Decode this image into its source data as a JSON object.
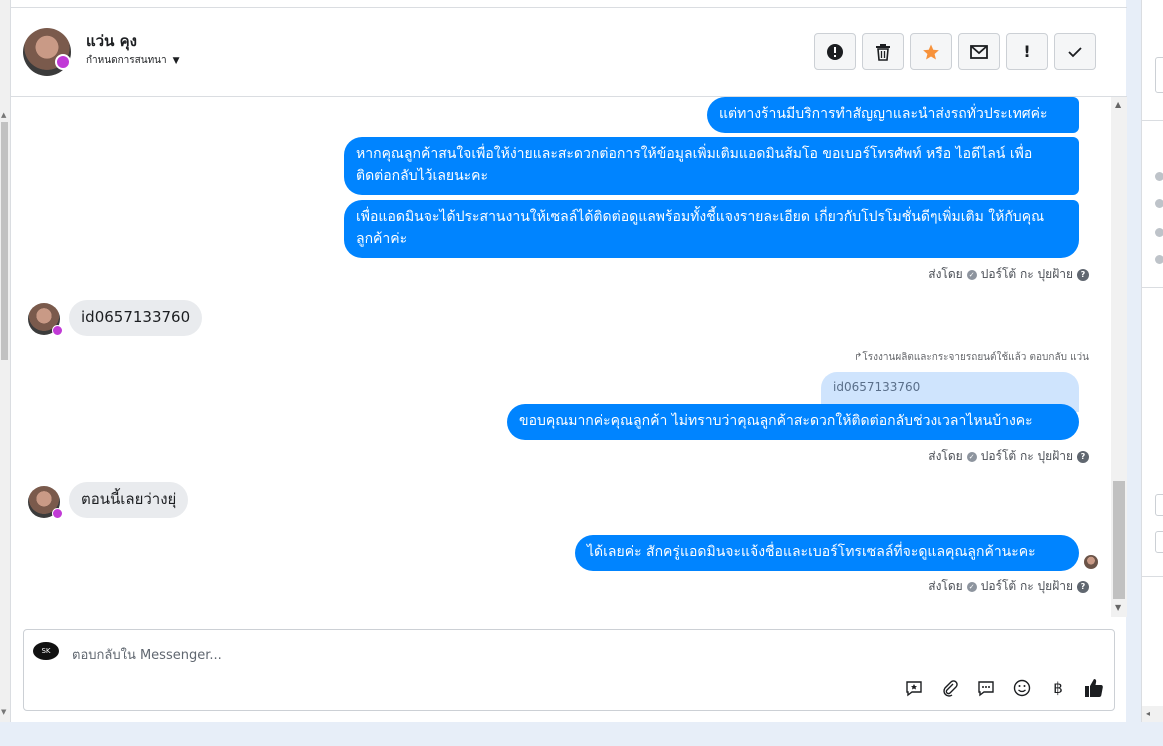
{
  "header": {
    "contact_name": "แว่น คุง",
    "label_dropdown": "กำหนดการสนทนา"
  },
  "toolbar": {
    "buttons": [
      {
        "name": "spam-button",
        "icon": "alert-circle-icon"
      },
      {
        "name": "delete-button",
        "icon": "trash-icon"
      },
      {
        "name": "star-button",
        "icon": "star-icon",
        "color": "#f7923b"
      },
      {
        "name": "mark-unread-button",
        "icon": "envelope-icon"
      },
      {
        "name": "follow-up-button",
        "icon": "exclamation-icon"
      },
      {
        "name": "done-button",
        "icon": "checkmark-icon"
      }
    ]
  },
  "conversation": {
    "out_1": "แต่ทางร้านมีบริการทำสัญญาและนำส่งรถทั่วประเทศค่ะ",
    "out_2": "หากคุณลูกค้าสนใจเพื่อให้ง่ายและสะดวกต่อการให้ข้อมูลเพิ่มเติมแอดมินส้มโอ ขอเบอร์โทรศัพท์ หรือ ไอดีไลน์ เพื่อติดต่อกลับไว้เลยนะคะ",
    "out_3": "เพื่อแอดมินจะได้ประสานงานให้เซลล์ได้ติดต่อดูแลพร้อมทั้งชี้แจงรายละเอียด เกี่ยวกับโปรโมชั่นดีๆเพิ่มเติม ให้กับคุณลูกค้าค่ะ",
    "sent_by_1": "ส่งโดย",
    "sender_1": "ปอร์โต้ กะ ปุยฝ้าย",
    "in_1": "id0657133760",
    "reply_note": "โรงงานผลิตและกระจายรถยนต์ใช้แล้ว ตอบกลับ แว่น",
    "quoted": "id0657133760",
    "out_4": "ขอบคุณมากค่ะคุณลูกค้า ไม่ทราบว่าคุณลูกค้าสะดวกให้ติดต่อกลับช่วงเวลาไหนบ้างคะ",
    "sent_by_2": "ส่งโดย",
    "sender_2": "ปอร์โต้ กะ ปุยฝ้าย",
    "in_2": "ตอนนี้เลยว่างยุ่",
    "out_5": "ได้เลยค่ะ สักครู่แอดมินจะแจ้งชื่อและเบอร์โทรเซลล์ที่จะดูแลคุณลูกค้านะคะ",
    "sent_by_3": "ส่งโดย",
    "sender_3": "ปอร์โต้ กะ ปุยฝ้าย"
  },
  "composer": {
    "placeholder": "ตอบกลับใน Messenger...",
    "tools": [
      "saved-reply-icon",
      "attachment-icon",
      "chat-bubble-icon",
      "emoji-icon",
      "baht-icon",
      "thumbs-up-icon"
    ]
  },
  "colors": {
    "outgoing_bubble": "#0084ff",
    "incoming_bubble": "#e9ebee"
  }
}
